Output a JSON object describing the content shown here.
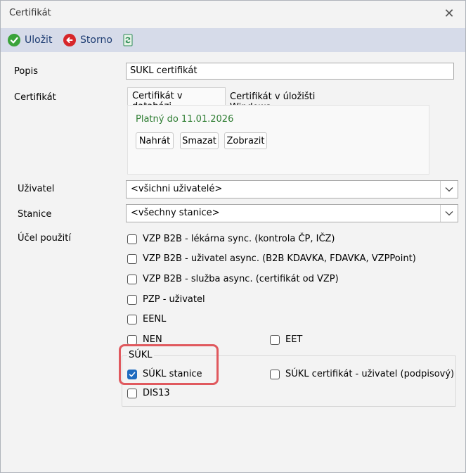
{
  "window": {
    "title": "Certifikát"
  },
  "toolbar": {
    "save_label": "Uložit",
    "cancel_label": "Storno"
  },
  "form": {
    "popis_label": "Popis",
    "popis_value": "SUKL certifikát",
    "certifikat_label": "Certifikát",
    "tabs": [
      "Certifikát v databázi",
      "Certifikát v úložišti Windows"
    ],
    "valid_text": "Platný do 11.01.2026",
    "buttons": {
      "upload": "Nahrát",
      "delete": "Smazat",
      "show": "Zobrazit"
    },
    "uzivatel_label": "Uživatel",
    "uzivatel_value": "<všichni uživatelé>",
    "stanice_label": "Stanice",
    "stanice_value": "<všechny stanice>",
    "ucel_label": "Účel použití",
    "checkboxes": {
      "vzp_lekarna": {
        "label": "VZP B2B - lékárna sync. (kontrola ČP, IČZ)",
        "checked": false
      },
      "vzp_uzivatel": {
        "label": "VZP B2B - uživatel async. (B2B KDAVKA, FDAVKA, VZPPoint)",
        "checked": false
      },
      "vzp_sluzba": {
        "label": "VZP B2B - služba async. (certifikát od VZP)",
        "checked": false
      },
      "pzp": {
        "label": "PZP - uživatel",
        "checked": false
      },
      "eenl": {
        "label": "EENL",
        "checked": false
      },
      "nen": {
        "label": "NEN",
        "checked": false
      },
      "eet": {
        "label": "EET",
        "checked": false
      }
    },
    "sukl_group": {
      "title": "SÚKL",
      "stanice": {
        "label": "SÚKL stanice",
        "checked": true
      },
      "certifikat_uzivatel": {
        "label": "SÚKL certifikát - uživatel (podpisový)",
        "checked": false
      },
      "dis13": {
        "label": "DIS13",
        "checked": false
      }
    }
  },
  "colors": {
    "toolbar_bg": "#d6dbe9",
    "accent": "#1e6bbf",
    "highlight": "#e0595e",
    "valid_green": "#2e7d32"
  }
}
